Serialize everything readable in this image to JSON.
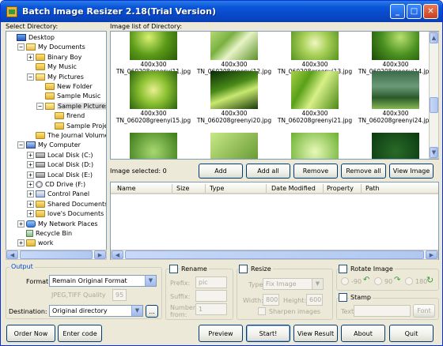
{
  "window": {
    "title": "Batch Image Resizer 2.18(Trial Version)",
    "minimize": "_",
    "maximize": "□",
    "close": "✕"
  },
  "tree": {
    "label": "Select Directory:",
    "nodes": [
      {
        "text": "Desktop",
        "pm": "",
        "icon": "desktop"
      },
      {
        "text": "My Documents",
        "pm": "−",
        "icon": "folderopen"
      },
      {
        "text": "Binary Boy",
        "pm": "+",
        "icon": "folder"
      },
      {
        "text": "My Music",
        "pm": "",
        "icon": "folder"
      },
      {
        "text": "My Pictures",
        "pm": "−",
        "icon": "folderopen"
      },
      {
        "text": "New Folder",
        "pm": "",
        "icon": "folder"
      },
      {
        "text": "Sample Music",
        "pm": "",
        "icon": "folder"
      },
      {
        "text": "Sample Pictures",
        "pm": "−",
        "icon": "folderopen"
      },
      {
        "text": "firend",
        "pm": "",
        "icon": "folder"
      },
      {
        "text": "Sample Project.l",
        "pm": "",
        "icon": "folder"
      },
      {
        "text": "The Journal Volumes",
        "pm": "",
        "icon": "folder"
      },
      {
        "text": "My Computer",
        "pm": "−",
        "icon": "computer"
      },
      {
        "text": "Local Disk (C:)",
        "pm": "+",
        "icon": "drive"
      },
      {
        "text": "Local Disk (D:)",
        "pm": "+",
        "icon": "drive"
      },
      {
        "text": "Local Disk (E:)",
        "pm": "+",
        "icon": "drive"
      },
      {
        "text": "CD Drive (F:)",
        "pm": "+",
        "icon": "cd"
      },
      {
        "text": "Control Panel",
        "pm": "+",
        "icon": "cp"
      },
      {
        "text": "Shared Documents",
        "pm": "+",
        "icon": "folder"
      },
      {
        "text": "love's Documents",
        "pm": "+",
        "icon": "folder"
      },
      {
        "text": "My Network Places",
        "pm": "+",
        "icon": "net"
      },
      {
        "text": "Recycle Bin",
        "pm": "",
        "icon": "bin"
      },
      {
        "text": "work",
        "pm": "+",
        "icon": "folder"
      }
    ]
  },
  "images": {
    "label": "Image list of Directory:",
    "items": [
      {
        "size": "400x300",
        "name": "TN_060208greenyi11.jpg"
      },
      {
        "size": "400x300",
        "name": "TN_060208greenyi12.jpg"
      },
      {
        "size": "400x300",
        "name": "TN_060208greenyi13.jpg"
      },
      {
        "size": "400x300",
        "name": "TN_060208greenyi14.jpg"
      },
      {
        "size": "400x300",
        "name": "TN_060208greenyi15.jpg"
      },
      {
        "size": "400x300",
        "name": "TN_060208greenyi20.jpg"
      },
      {
        "size": "400x300",
        "name": "TN_060208greenyi21.jpg"
      },
      {
        "size": "400x300",
        "name": "TN_060208greenyi24.jpg"
      }
    ]
  },
  "selection": {
    "label": "Image selected: 0",
    "add": "Add",
    "add_all": "Add all",
    "remove": "Remove",
    "remove_all": "Remove all",
    "view_image": "View Image"
  },
  "list": {
    "columns": [
      "Name",
      "Size",
      "Type",
      "Date Modified",
      "Property",
      "Path"
    ]
  },
  "output": {
    "title": "Output",
    "format_label": "Format:",
    "format_value": "Remain Original Format",
    "quality_label": "JPEG,TIFF Quality",
    "quality_value": "95",
    "destination_label": "Destination:",
    "destination_value": "Original directory",
    "browse": "..."
  },
  "rename": {
    "label": "Rename",
    "prefix_label": "Prefix:",
    "prefix_value": "pic",
    "suffix_label": "Suffix:",
    "number_label": "Number",
    "number_label2": "from:",
    "number_value": "1"
  },
  "resize": {
    "label": "Resize",
    "type_label": "Type",
    "type_value": "Fix Image",
    "width_label": "Width:",
    "width_value": "800",
    "height_label": "Height:",
    "height_value": "600",
    "sharpen_label": "Sharpen images"
  },
  "rotate": {
    "label": "Rotate Image",
    "opt1": "-90",
    "opt2": "90",
    "opt3": "180"
  },
  "stamp": {
    "label": "Stamp",
    "text_label": "Text:",
    "font": "Font"
  },
  "footer": {
    "order_now": "Order Now",
    "enter_code": "Enter code",
    "preview": "Preview",
    "start": "Start!",
    "view_result": "View Result",
    "about": "About",
    "quit": "Quit"
  },
  "colors": {
    "titlebar": "#0a55d8",
    "window_bg": "#ece9d8",
    "output_title": "#0046d5"
  }
}
